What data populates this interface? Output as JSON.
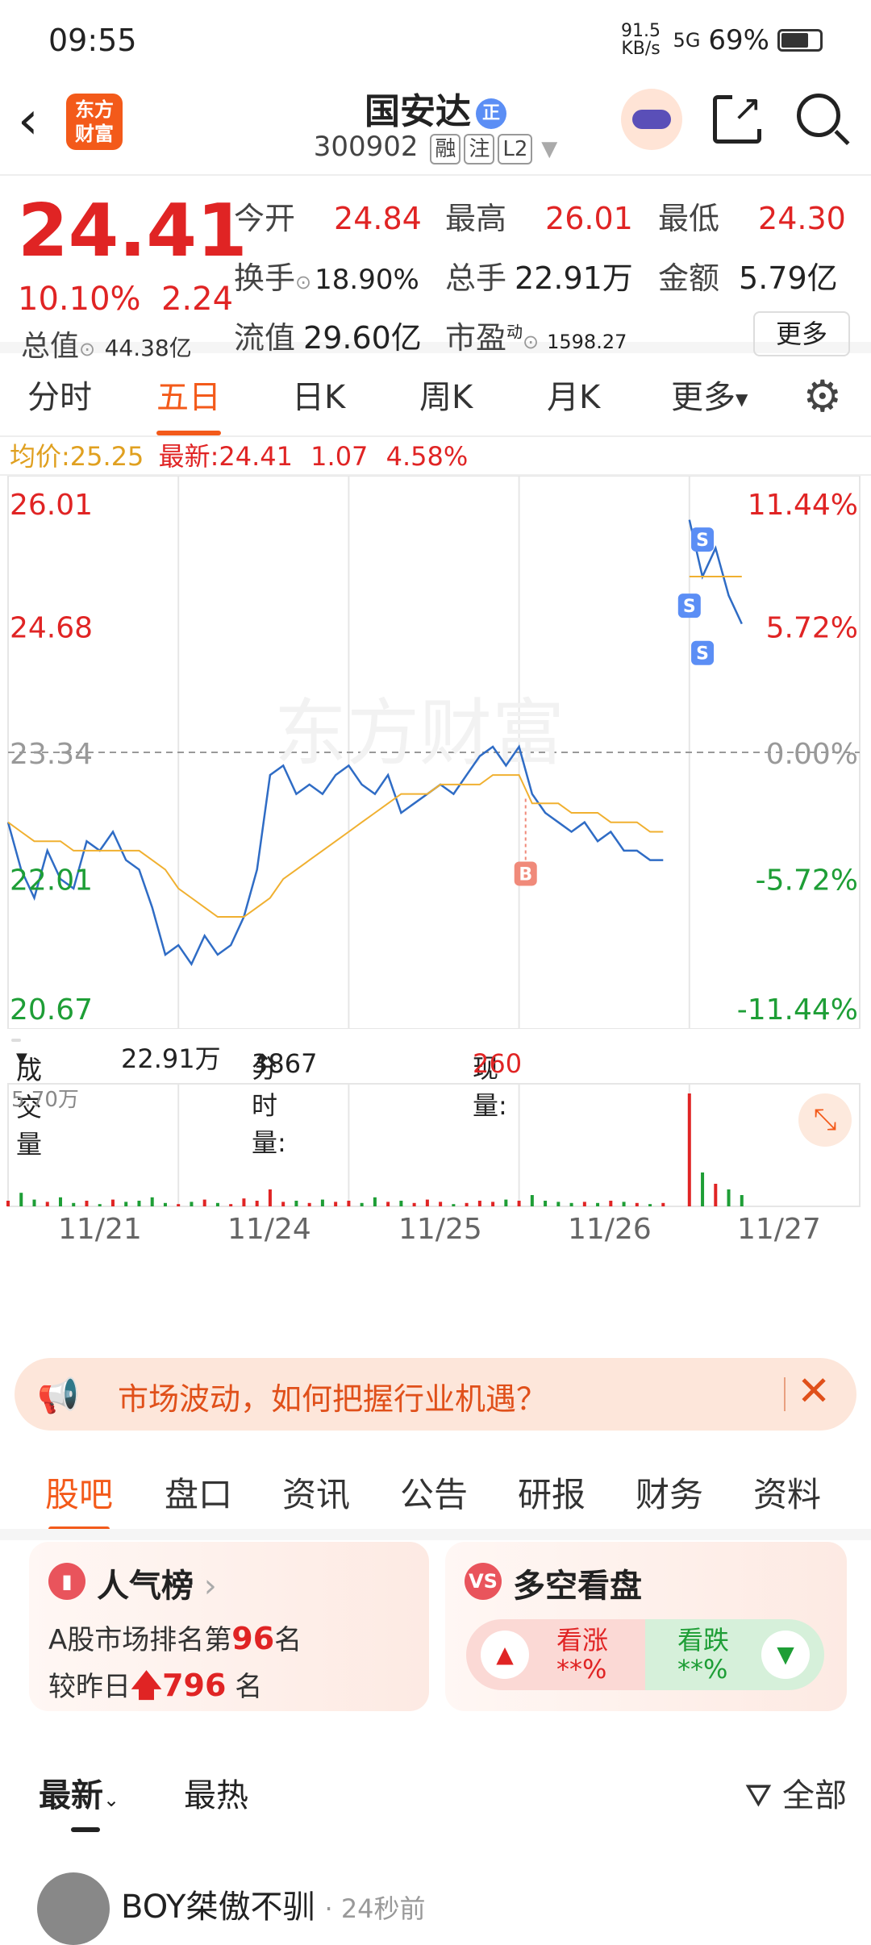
{
  "status": {
    "time": "09:55",
    "net_speed": "91.5 KB/s",
    "signal": "5G",
    "battery": "69%"
  },
  "header": {
    "title": "国安达",
    "badge": "正",
    "code": "300902",
    "tags": [
      "融",
      "注",
      "L2"
    ],
    "logo_text": "东方财富"
  },
  "quote": {
    "price": "24.41",
    "change_pct": "10.10%",
    "change": "2.24",
    "open_label": "今开",
    "open": "24.84",
    "high_label": "最高",
    "high": "26.01",
    "low_label": "最低",
    "low": "24.30",
    "turnover_label": "换手",
    "turnover": "18.90%",
    "volume_label": "总手",
    "volume": "22.91万",
    "amount_label": "金额",
    "amount": "5.79亿",
    "mktcap_label": "总值",
    "mktcap": "44.38亿",
    "float_label": "流值",
    "float": "29.60亿",
    "pe_label": "市盈",
    "pe_sup": "动",
    "pe": "1598.27",
    "more_label": "更多"
  },
  "tabs": [
    "分时",
    "五日",
    "日K",
    "周K",
    "月K",
    "更多"
  ],
  "active_tab": "五日",
  "infoline": {
    "avg_label": "均价:",
    "avg": "25.25",
    "latest_label": "最新:",
    "latest": "24.41",
    "chg": "1.07",
    "pct": "4.58%"
  },
  "chart_data": {
    "type": "line",
    "title": "",
    "y_left_ticks": [
      "26.01",
      "24.68",
      "23.34",
      "22.01",
      "20.67"
    ],
    "y_right_ticks": [
      "11.44%",
      "5.72%",
      "0.00%",
      "-5.72%",
      "-11.44%"
    ],
    "ylim": [
      20.67,
      26.01
    ],
    "x_labels": [
      "11/21",
      "11/24",
      "11/25",
      "11/26",
      "11/27"
    ],
    "prev_close": 23.34,
    "watermark": "东方财富",
    "series": [
      {
        "values": [
          22.6,
          22.1,
          21.8,
          22.3,
          22.0,
          21.9,
          22.4,
          22.3,
          22.5,
          22.2,
          22.1,
          21.7,
          21.2,
          21.3,
          21.1,
          21.4,
          21.2,
          21.3,
          21.6,
          22.1,
          23.1,
          23.2,
          22.9,
          23.0,
          22.9,
          23.1,
          23.2,
          23.0,
          22.9,
          23.1,
          22.7,
          22.8,
          22.9,
          23.0,
          22.9,
          23.1,
          23.3,
          23.4,
          23.2,
          23.4,
          22.9,
          22.7,
          22.6,
          22.5,
          22.6,
          22.4,
          22.5,
          22.3,
          22.3,
          22.2,
          22.2,
          25.8,
          25.2,
          25.5,
          25.0,
          24.7
        ]
      },
      {
        "values": [
          22.6,
          22.5,
          22.4,
          22.4,
          22.4,
          22.3,
          22.3,
          22.3,
          22.3,
          22.3,
          22.3,
          22.2,
          22.1,
          21.9,
          21.8,
          21.7,
          21.6,
          21.6,
          21.6,
          21.7,
          21.8,
          22.0,
          22.1,
          22.2,
          22.3,
          22.4,
          22.5,
          22.6,
          22.7,
          22.8,
          22.9,
          22.9,
          22.9,
          23.0,
          23.0,
          23.0,
          23.0,
          23.1,
          23.1,
          23.1,
          22.8,
          22.8,
          22.8,
          22.7,
          22.7,
          22.7,
          22.6,
          22.6,
          22.6,
          22.5,
          22.5,
          25.2,
          25.2,
          25.2,
          25.2,
          25.2
        ]
      }
    ],
    "markers": [
      {
        "label": "B",
        "x": 39.5,
        "y": 22.85
      },
      {
        "label": "S",
        "x": 53,
        "y": 25.6
      },
      {
        "label": "S",
        "x": 52,
        "y": 24.9
      },
      {
        "label": "S",
        "x": 53,
        "y": 24.4
      }
    ]
  },
  "volume": {
    "label": "成交量",
    "total": "22.91万",
    "minute_label": "分时量:",
    "minute": "3867",
    "now_label": "现量:",
    "now": "260",
    "max_tick": "5.70万",
    "values": [
      0.05,
      0.12,
      0.06,
      0.04,
      0.08,
      0.03,
      0.05,
      0.02,
      0.06,
      0.04,
      0.05,
      0.08,
      0.03,
      0.02,
      0.04,
      0.06,
      0.03,
      0.02,
      0.07,
      0.05,
      0.15,
      0.04,
      0.05,
      0.03,
      0.06,
      0.04,
      0.05,
      0.03,
      0.08,
      0.04,
      0.05,
      0.03,
      0.06,
      0.04,
      0.02,
      0.03,
      0.05,
      0.04,
      0.06,
      0.05,
      0.1,
      0.05,
      0.04,
      0.03,
      0.04,
      0.03,
      0.05,
      0.04,
      0.03,
      0.02,
      0.03,
      1.0,
      0.3,
      0.2,
      0.15,
      0.1
    ]
  },
  "banner": {
    "text": "市场波动，如何把握行业机遇？"
  },
  "lower_tabs": [
    "股吧",
    "盘口",
    "资讯",
    "公告",
    "研报",
    "财务",
    "资料"
  ],
  "active_lower_tab": "股吧",
  "popularity": {
    "title": "人气榜",
    "line1_prefix": "A股市场排名第",
    "rank": "96",
    "line1_suffix": "名",
    "line2_prefix": "较昨日",
    "rank_change": "796",
    "line2_suffix": "名"
  },
  "sentiment": {
    "title": "多空看盘",
    "up_label": "看涨",
    "up_value": "**%",
    "down_label": "看跌",
    "down_value": "**%"
  },
  "feed": {
    "tabs": [
      "最新",
      "最热"
    ],
    "filter": "全部",
    "post_user": "BOY桀傲不驯",
    "post_time": "24秒前"
  },
  "colors": {
    "accent": "#f35a1a",
    "up": "#e02424",
    "down": "#1e9e36",
    "avg_line": "#f0b030",
    "price_line": "#2f6cc5"
  }
}
